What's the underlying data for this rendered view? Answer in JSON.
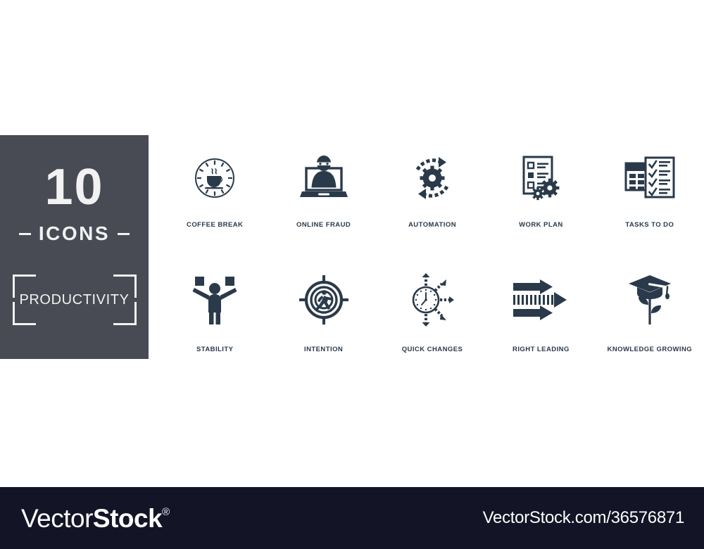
{
  "title_card": {
    "count": "10",
    "icons_word": "ICONS",
    "category": "PRODUCTIVITY",
    "background_color": "#484b54",
    "text_color": "#f2f2f2",
    "left_dash": "",
    "right_dash": ""
  },
  "icon_color": "#2a3a4a",
  "page_background": "#ffffff",
  "grid": {
    "rows": [
      {
        "cells": [
          {
            "label": "COFFEE BREAK",
            "icon": "coffee-break-clock-icon"
          },
          {
            "label": "ONLINE FRAUD",
            "icon": "online-fraud-laptop-thief-icon"
          },
          {
            "label": "AUTOMATION",
            "icon": "automation-gear-cycle-icon"
          },
          {
            "label": "WORK PLAN",
            "icon": "work-plan-document-gears-icon"
          },
          {
            "label": "TASKS TO DO",
            "icon": "tasks-to-do-calendar-checklist-icon"
          }
        ]
      },
      {
        "cells": [
          {
            "label": "STABILITY",
            "icon": "stability-person-balance-icon"
          },
          {
            "label": "INTENTION",
            "icon": "intention-target-runner-icon"
          },
          {
            "label": "QUICK CHANGES",
            "icon": "quick-changes-clock-arrows-icon"
          },
          {
            "label": "RIGHT LEADING",
            "icon": "right-leading-arrows-icon"
          },
          {
            "label": "KNOWLEDGE GROWING",
            "icon": "knowledge-growing-cap-plant-icon"
          }
        ]
      }
    ]
  },
  "footer": {
    "brand_light": "Vector",
    "brand_bold": "Stock",
    "brand_registered": "®",
    "url": "VectorStock.com/36576871",
    "background_color": "#131426",
    "text_color": "#ffffff"
  }
}
